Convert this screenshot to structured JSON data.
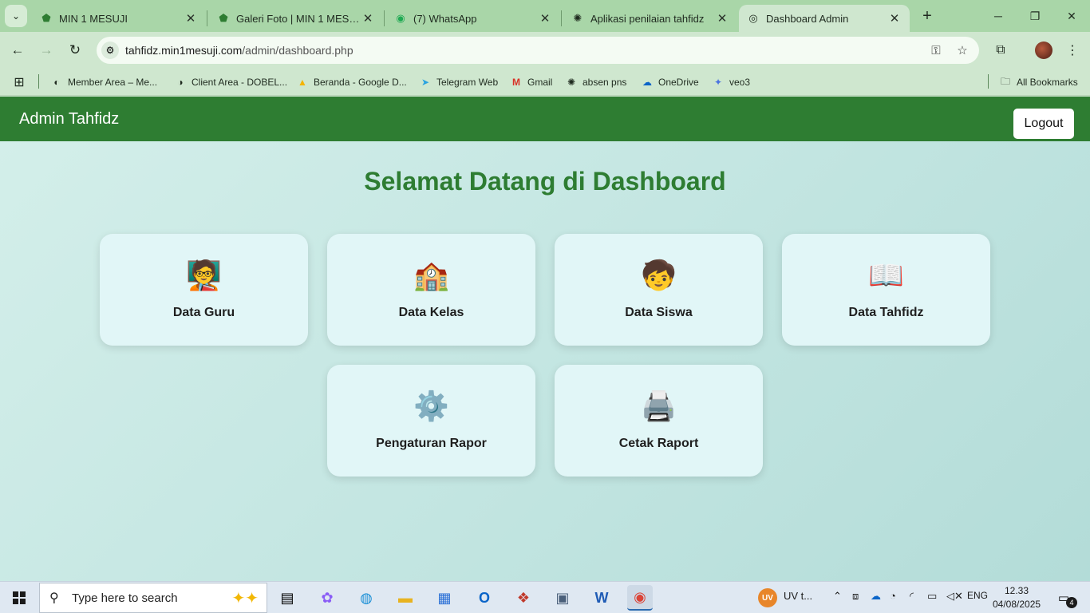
{
  "browser": {
    "tabs": [
      {
        "title": "MIN 1 MESUJI",
        "icon": "school-logo-icon"
      },
      {
        "title": "Galeri Foto | MIN 1 MESUJI",
        "icon": "school-logo-icon"
      },
      {
        "title": "(7) WhatsApp",
        "icon": "whatsapp-icon"
      },
      {
        "title": "Aplikasi penilaian tahfidz",
        "icon": "openai-icon"
      },
      {
        "title": "Dashboard Admin",
        "icon": "globe-icon"
      }
    ],
    "active_tab": 4,
    "url_host": "tahfidz.min1mesuji.com",
    "url_path": "/admin/dashboard.php",
    "bookmarks": [
      {
        "label": "Member Area – Me...",
        "icon": "member-area-icon"
      },
      {
        "label": "Client Area - DOBEL...",
        "icon": "client-area-icon"
      },
      {
        "label": "Beranda - Google D...",
        "icon": "google-drive-icon"
      },
      {
        "label": "Telegram Web",
        "icon": "telegram-icon"
      },
      {
        "label": "Gmail",
        "icon": "gmail-icon"
      },
      {
        "label": "absen pns",
        "icon": "openai-icon"
      },
      {
        "label": "OneDrive",
        "icon": "onedrive-icon"
      },
      {
        "label": "veo3",
        "icon": "gemini-icon"
      }
    ],
    "all_bookmarks_label": "All Bookmarks"
  },
  "app": {
    "brand": "Admin Tahfidz",
    "logout_label": "Logout",
    "welcome": "Selamat Datang di Dashboard",
    "cards": [
      {
        "emoji": "🧑‍🏫",
        "label": "Data Guru"
      },
      {
        "emoji": "🏫",
        "label": "Data Kelas"
      },
      {
        "emoji": "🧒",
        "label": "Data Siswa"
      },
      {
        "emoji": "📖",
        "label": "Data Tahfidz"
      },
      {
        "emoji": "⚙️",
        "label": "Pengaturan Rapor"
      },
      {
        "emoji": "🖨️",
        "label": "Cetak Raport"
      }
    ]
  },
  "taskbar": {
    "search_placeholder": "Type here to search",
    "uv_badge": "UV",
    "uv_label": "UV t...",
    "language": "ENG",
    "time": "12.33",
    "date": "04/08/2025",
    "notification_count": "4"
  },
  "colors": {
    "header_green": "#2e7d32",
    "title_green": "#2e7d32",
    "card_bg": "#e1f6f7"
  }
}
